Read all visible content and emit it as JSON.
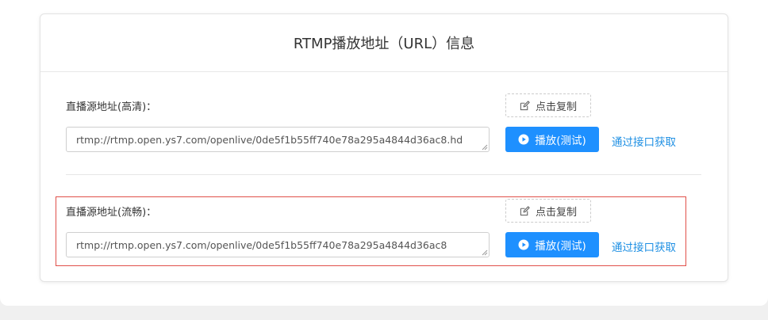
{
  "card": {
    "title": "RTMP播放地址（URL）信息"
  },
  "sources": [
    {
      "label": "直播源地址(高清)：",
      "copy_label": "点击复制",
      "url": "rtmp://rtmp.open.ys7.com/openlive/0de5f1b55ff740e78a295a4844d36ac8.hd",
      "play_label": "播放(测试)",
      "api_label": "通过接口获取"
    },
    {
      "label": "直播源地址(流畅)：",
      "copy_label": "点击复制",
      "url": "rtmp://rtmp.open.ys7.com/openlive/0de5f1b55ff740e78a295a4844d36ac8",
      "play_label": "播放(测试)",
      "api_label": "通过接口获取"
    }
  ],
  "colors": {
    "primary": "#1e90ff",
    "link": "#1e8fe3",
    "highlight": "#e0504a"
  }
}
